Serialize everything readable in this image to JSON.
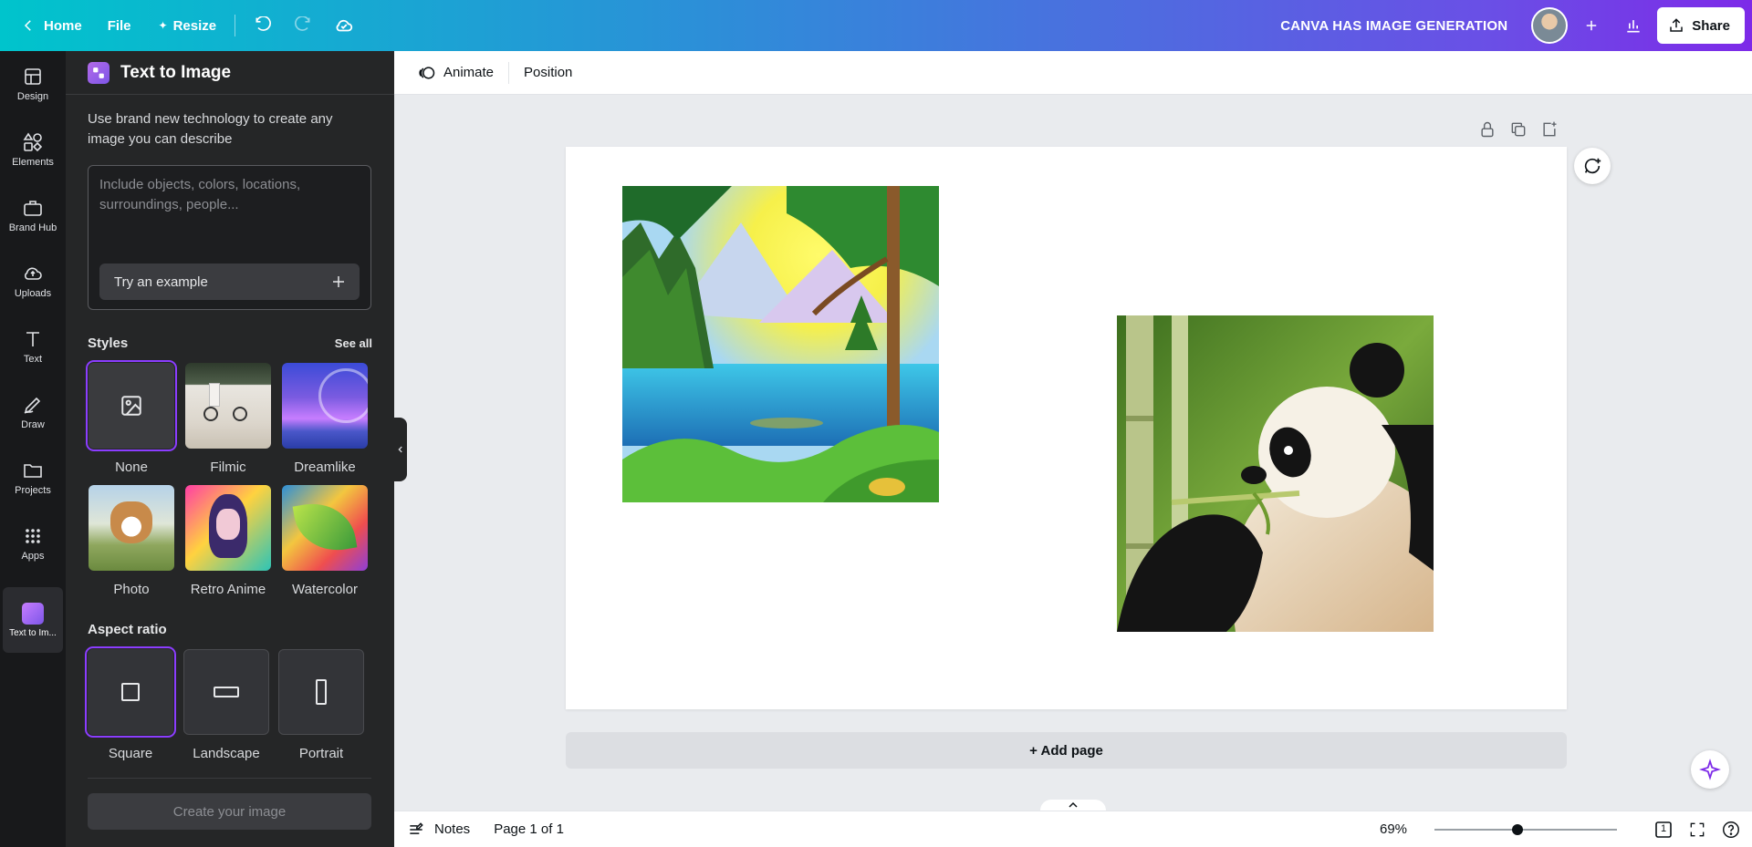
{
  "topbar": {
    "home_label": "Home",
    "file_label": "File",
    "resize_label": "Resize",
    "doc_title": "CANVA HAS IMAGE GENERATION",
    "share_label": "Share"
  },
  "rail": {
    "items": [
      {
        "label": "Design"
      },
      {
        "label": "Elements"
      },
      {
        "label": "Brand Hub"
      },
      {
        "label": "Uploads"
      },
      {
        "label": "Text"
      },
      {
        "label": "Draw"
      },
      {
        "label": "Projects"
      },
      {
        "label": "Apps"
      },
      {
        "label": "Text to Im..."
      }
    ]
  },
  "panel": {
    "title": "Text to Image",
    "description": "Use brand new technology to create any image you can describe",
    "prompt_placeholder": "Include objects, colors, locations, surroundings, people...",
    "try_example": "Try an example",
    "styles_label": "Styles",
    "see_all": "See all",
    "styles": [
      {
        "name": "None",
        "selected": true
      },
      {
        "name": "Filmic"
      },
      {
        "name": "Dreamlike"
      },
      {
        "name": "Photo"
      },
      {
        "name": "Retro Anime"
      },
      {
        "name": "Watercolor"
      }
    ],
    "aspect_label": "Aspect ratio",
    "aspects": [
      {
        "name": "Square",
        "selected": true
      },
      {
        "name": "Landscape"
      },
      {
        "name": "Portrait"
      }
    ],
    "create_label": "Create your image"
  },
  "context": {
    "animate_label": "Animate",
    "position_label": "Position"
  },
  "canvas": {
    "add_page_label": "+ Add page",
    "images": [
      "mountain-lake-illustration",
      "panda-eating-bamboo-photo"
    ]
  },
  "bottom": {
    "notes_label": "Notes",
    "page_label": "Page 1 of 1",
    "zoom": "69%",
    "zoom_fraction": 0.69,
    "page_count": "1"
  },
  "colors": {
    "accent": "#8b3dff",
    "panel_bg": "#252627",
    "rail_bg": "#18191b"
  }
}
